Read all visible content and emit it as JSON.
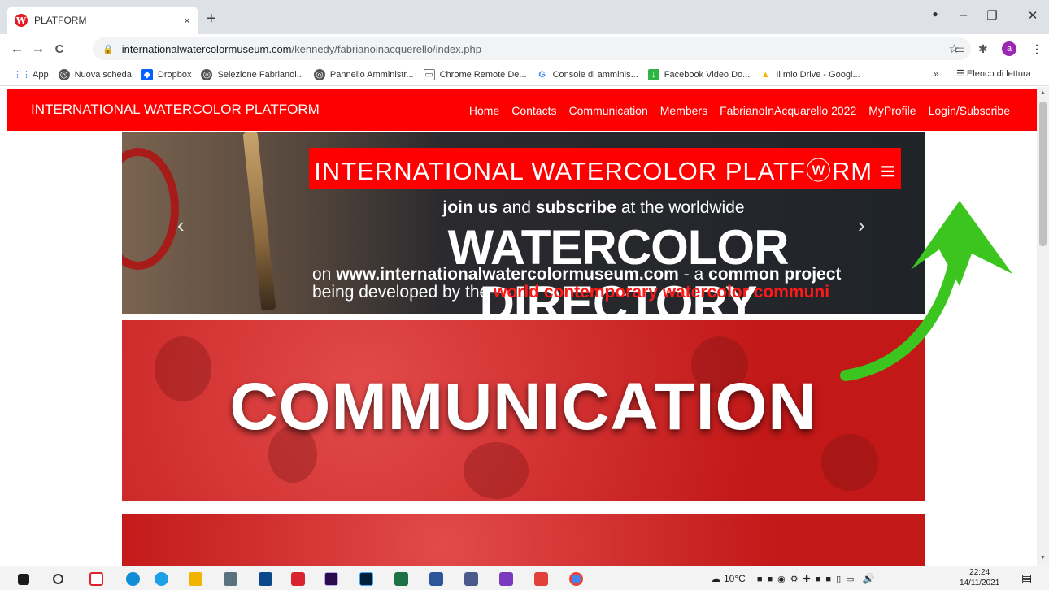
{
  "browser": {
    "tab_title": "PLATFORM",
    "tab_close": "×",
    "new_tab": "+",
    "window_controls": {
      "minimize": "–",
      "restore": "❐",
      "close": "✕"
    },
    "nav": {
      "back": "←",
      "forward": "→",
      "reload": "C"
    },
    "url": {
      "domain": "internationalwatercolormuseum.com",
      "path": "/kennedy/fabrianoinacquerello/index.php"
    },
    "profile_initial": "a"
  },
  "bookmarks": {
    "items": [
      {
        "label": "App",
        "icon": "apps-grid-icon"
      },
      {
        "label": "Nuova scheda",
        "icon": "globe-icon"
      },
      {
        "label": "Dropbox",
        "icon": "dropbox-icon"
      },
      {
        "label": "Selezione Fabrianol...",
        "icon": "globe-icon"
      },
      {
        "label": "Pannello Amministr...",
        "icon": "globe-icon"
      },
      {
        "label": "Chrome Remote De...",
        "icon": "remote-desktop-icon"
      },
      {
        "label": "Console di amminis...",
        "icon": "google-icon"
      },
      {
        "label": "Facebook Video Do...",
        "icon": "download-icon"
      },
      {
        "label": "Il mio Drive - Googl...",
        "icon": "drive-icon"
      }
    ],
    "more": "»",
    "reading_list": "Elenco di lettura"
  },
  "site": {
    "brand": "INTERNATIONAL WATERCOLOR PLATFORM",
    "menu": [
      "Home",
      "Contacts",
      "Communication",
      "Members",
      "FabrianoInAcquarello 2022",
      "MyProfile",
      "Login/Subscribe"
    ],
    "brand_color": "#ff0000"
  },
  "hero": {
    "band": "INTERNATIONAL WATERCOLOR PLATFⓦRM ≡",
    "line1_bold1": "join us",
    "line1_mid": " and ",
    "line1_bold2": "subscribe",
    "line1_end": " at the worldwide",
    "line2": "WATERCOLOR DIRECTORY",
    "line3_pre": "on ",
    "line3_bold": "www.internationalwatercolormuseum.com",
    "line3_mid": " - a ",
    "line3_bold2": "common project",
    "line4_pre": "being developed by the ",
    "line4_red": "world contemporary watercolor communi",
    "prev": "‹",
    "next": "›"
  },
  "banner": {
    "text": "COMMUNICATION"
  },
  "taskbar": {
    "weather": "10°C",
    "time": "22:24",
    "date": "14/11/2021"
  }
}
